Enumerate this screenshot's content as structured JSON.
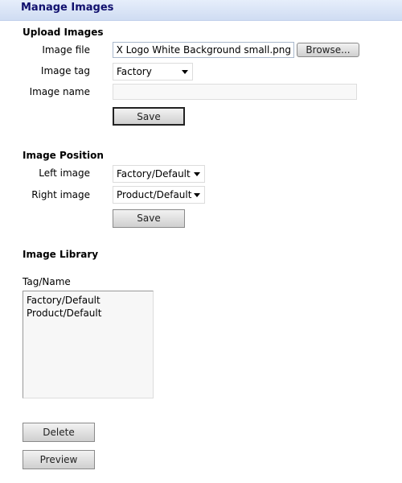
{
  "header": {
    "title": "Manage Images"
  },
  "upload": {
    "title": "Upload Images",
    "file_label": "Image file",
    "file_value": "- X Logo White Background small.png",
    "browse_label": "Browse...",
    "tag_label": "Image tag",
    "tag_value": "Factory",
    "name_label": "Image name",
    "name_value": "",
    "save_label": "Save"
  },
  "position": {
    "title": "Image Position",
    "left_label": "Left image",
    "left_value": "Factory/Default",
    "right_label": "Right image",
    "right_value": "Product/Default",
    "save_label": "Save"
  },
  "library": {
    "title": "Image Library",
    "column_label": "Tag/Name",
    "items": [
      "Factory/Default",
      "Product/Default"
    ],
    "delete_label": "Delete",
    "preview_label": "Preview"
  }
}
